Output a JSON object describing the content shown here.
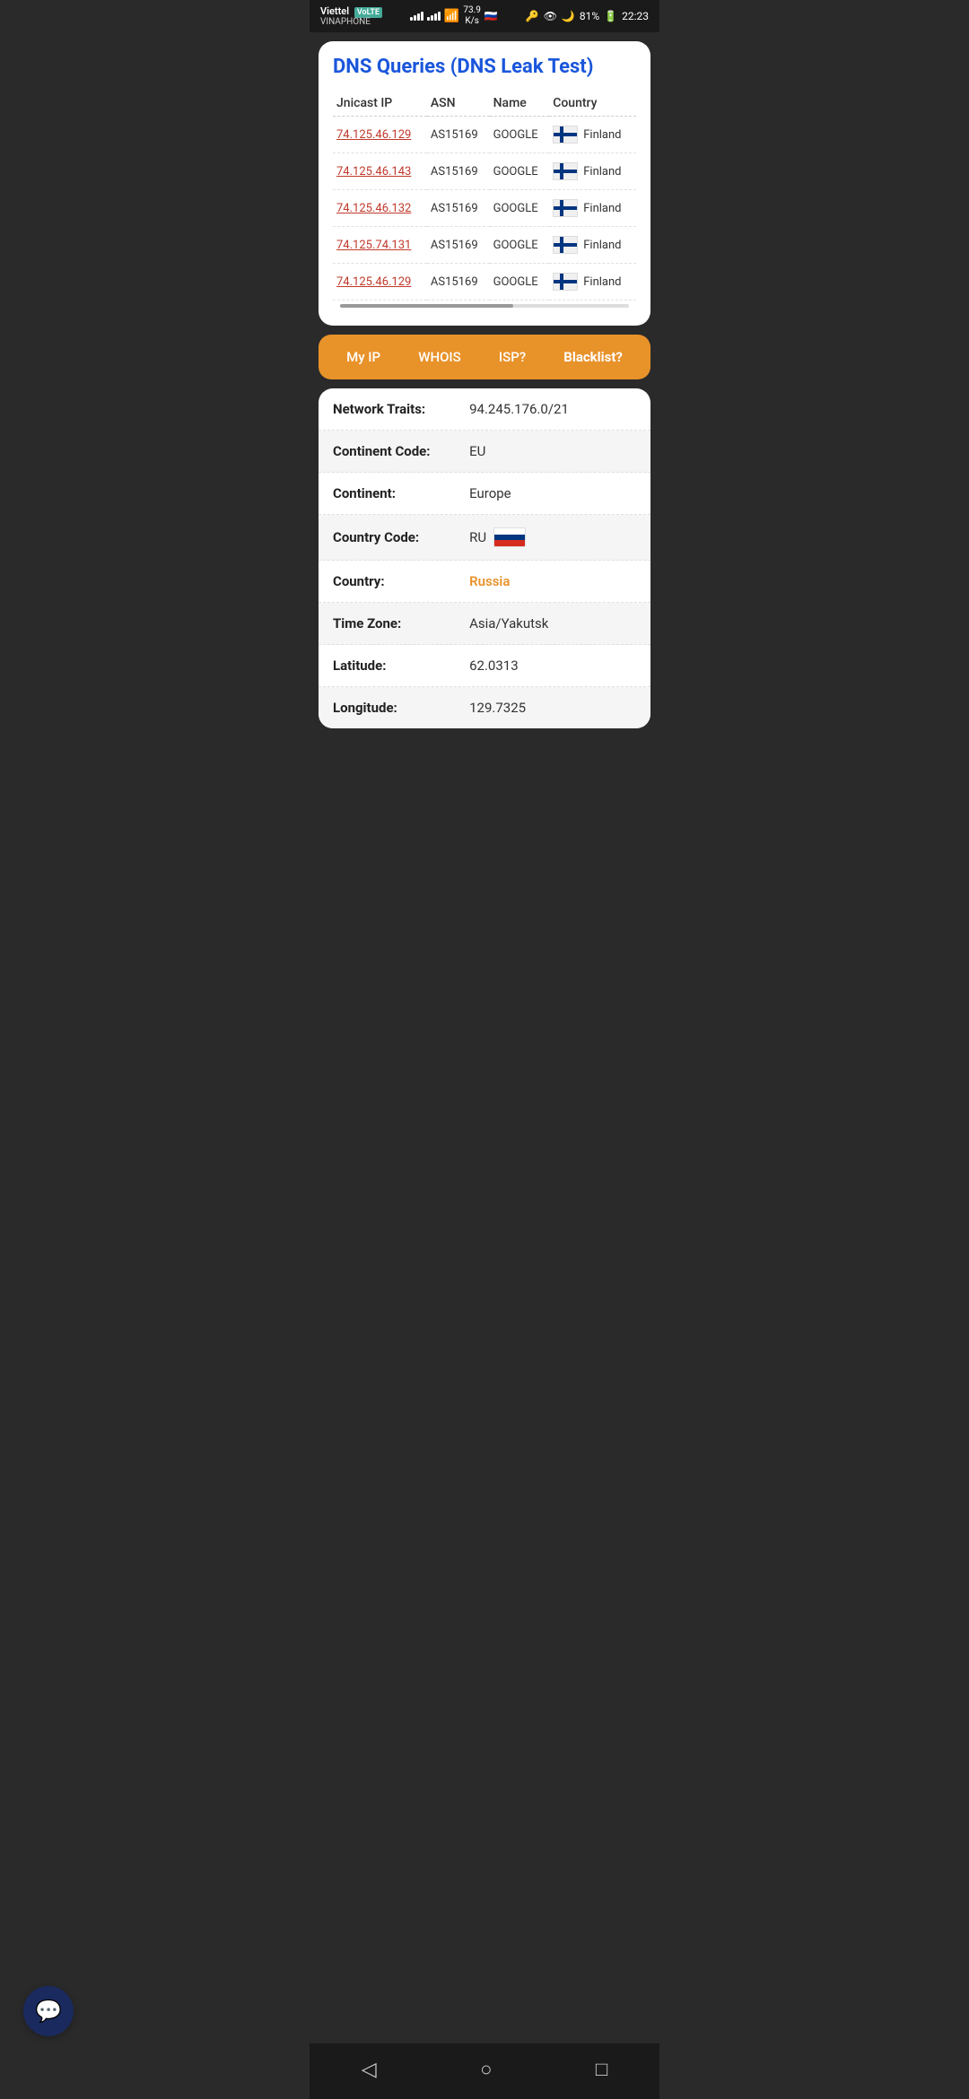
{
  "statusBar": {
    "carrier": "Viettel",
    "networkType": "VoLTE",
    "operator": "VINAPHONE",
    "speed": "73.9",
    "speedUnit": "K/s",
    "battery": "81%",
    "time": "22:23"
  },
  "dnsCard": {
    "title": "DNS Queries (DNS Leak Test)",
    "columns": {
      "ip": "Jnicast IP",
      "asn": "ASN",
      "name": "Name",
      "country": "Country"
    },
    "rows": [
      {
        "ip": "74.125.46.129",
        "asn": "AS15169",
        "name": "GOOGLE",
        "country": "Finland"
      },
      {
        "ip": "74.125.46.143",
        "asn": "AS15169",
        "name": "GOOGLE",
        "country": "Finland"
      },
      {
        "ip": "74.125.46.132",
        "asn": "AS15169",
        "name": "GOOGLE",
        "country": "Finland"
      },
      {
        "ip": "74.125.74.131",
        "asn": "AS15169",
        "name": "GOOGLE",
        "country": "Finland"
      },
      {
        "ip": "74.125.46.129",
        "asn": "AS15169",
        "name": "GOOGLE",
        "country": "Finland"
      }
    ]
  },
  "tabs": [
    {
      "id": "my-ip",
      "label": "My IP"
    },
    {
      "id": "whois",
      "label": "WHOIS"
    },
    {
      "id": "isp",
      "label": "ISP?"
    },
    {
      "id": "blacklist",
      "label": "Blacklist?"
    }
  ],
  "infoRows": [
    {
      "label": "Network Traits:",
      "value": "94.245.176.0/21",
      "highlight": false,
      "alt": false,
      "hasFlag": false
    },
    {
      "label": "Continent Code:",
      "value": "EU",
      "highlight": false,
      "alt": true,
      "hasFlag": false
    },
    {
      "label": "Continent:",
      "value": "Europe",
      "highlight": false,
      "alt": false,
      "hasFlag": false
    },
    {
      "label": "Country Code:",
      "value": "RU",
      "highlight": false,
      "alt": true,
      "hasFlag": true
    },
    {
      "label": "Country:",
      "value": "Russia",
      "highlight": true,
      "alt": false,
      "hasFlag": false
    },
    {
      "label": "Time Zone:",
      "value": "Asia/Yakutsk",
      "highlight": false,
      "alt": true,
      "hasFlag": false
    },
    {
      "label": "Latitude:",
      "value": "62.0313",
      "highlight": false,
      "alt": false,
      "hasFlag": false
    },
    {
      "label": "Longitude:",
      "value": "129.7325",
      "highlight": false,
      "alt": true,
      "hasFlag": false
    }
  ],
  "chatButton": {
    "icon": "💬"
  },
  "navBar": {
    "back": "◁",
    "home": "○",
    "recent": "□"
  }
}
